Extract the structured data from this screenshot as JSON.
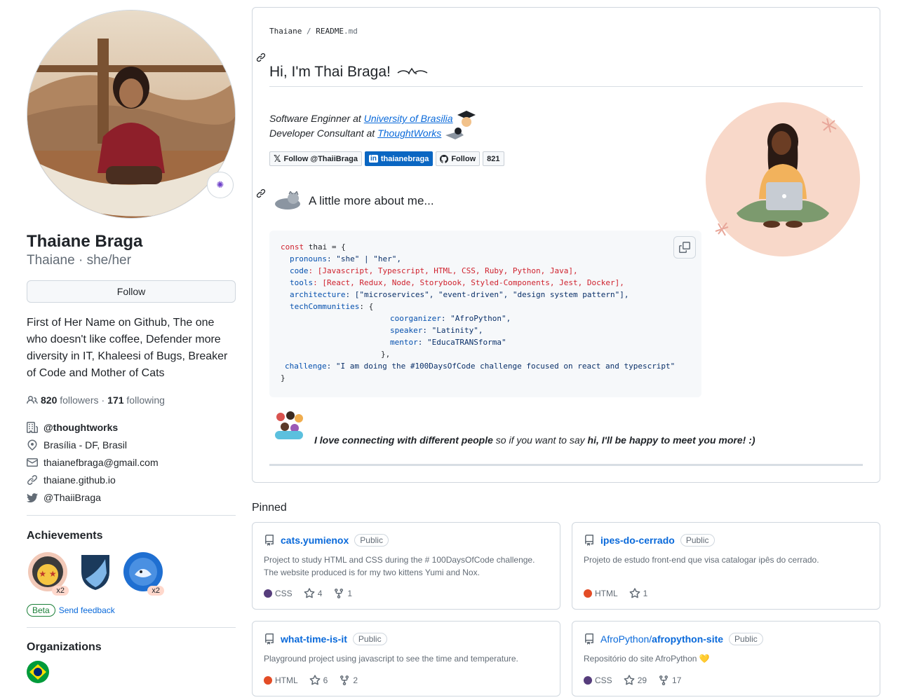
{
  "profile": {
    "name": "Thaiane Braga",
    "login": "Thaiane",
    "pronouns": "she/her",
    "follow_label": "Follow",
    "bio": "First of Her Name on Github, The one who doesn't like coffee, Defender more diversity in IT, Khaleesi of Bugs, Breaker of Code and Mother of Cats",
    "followers_count": "820",
    "followers_label": "followers",
    "following_count": "171",
    "following_label": "following",
    "company": "@thoughtworks",
    "location": "Brasília - DF, Brasil",
    "email": "thaianefbraga@gmail.com",
    "website": "thaiane.github.io",
    "twitter": "@ThaiiBraga"
  },
  "achievements": {
    "title": "Achievements",
    "items": [
      {
        "icon": "starstruck-cat-achievement-icon",
        "count": "x2"
      },
      {
        "icon": "shield-achievement-icon",
        "count": ""
      },
      {
        "icon": "shark-achievement-icon",
        "count": "x2"
      }
    ],
    "beta_label": "Beta",
    "feedback_label": "Send feedback"
  },
  "organizations": {
    "title": "Organizations"
  },
  "readme": {
    "path_user": "Thaiane",
    "path_sep": "/",
    "path_file": "README",
    "path_ext": ".md",
    "greeting": "Hi, I'm Thai Braga!",
    "job1_prefix": "Software Enginner at",
    "job1_link": "University of Brasilia",
    "job2_prefix": "Developer Consultant at",
    "job2_link": "ThoughtWorks",
    "badge_twitter": "Follow @ThaiiBraga",
    "badge_linkedin": "thaianebraga",
    "badge_github": "Follow",
    "badge_github_count": "821",
    "more_title": "A little more about me...",
    "love_lead": "I love connecting with different people",
    "love_mid": " so if you want to say ",
    "love_end": "hi, I'll be happy to meet you more! :)"
  },
  "code": {
    "l1_kw": "const",
    "l1_rest": " thai = {",
    "l2_key": "pronouns",
    "l2_val": ": \"she\" | \"her\",",
    "l3_key": "code",
    "l3_val": ": [Javascript, Typescript, HTML, CSS, Ruby, Python, Java],",
    "l4_key": "tools",
    "l4_val": ": [React, Redux, Node, Storybook, Styled-Components, Jest, Docker],",
    "l5_key": "architecture",
    "l5_val": ": [\"microservices\", \"event-driven\", \"design system pattern\"],",
    "l6_key": "techCommunities",
    "l6_val": ": {",
    "l7_key": "coorganizer",
    "l7_val": ": \"AfroPython\",",
    "l8_key": "speaker",
    "l8_val": ": \"Latinity\",",
    "l9_key": "mentor",
    "l9_val": ": \"EducaTRANSforma\"",
    "l10": "},",
    "l11_key": "challenge",
    "l11_val": ": \"I am doing the #100DaysOfCode challenge focused on react and typescript\"",
    "l12": "}"
  },
  "pinned": {
    "title": "Pinned",
    "cards": [
      {
        "owner": "",
        "name": "cats.yumienox",
        "visibility": "Public",
        "description": "Project to study HTML and CSS during the # 100DaysOfCode challenge. The website produced is for my two kittens Yumi and Nox.",
        "language": "CSS",
        "lang_color": "#563d7c",
        "stars": "4",
        "forks": "1"
      },
      {
        "owner": "",
        "name": "ipes-do-cerrado",
        "visibility": "Public",
        "description": "Projeto de estudo front-end que visa catalogar ipês do cerrado.",
        "language": "HTML",
        "lang_color": "#e34c26",
        "stars": "1",
        "forks": ""
      },
      {
        "owner": "",
        "name": "what-time-is-it",
        "visibility": "Public",
        "description": "Playground project using javascript to see the time and temperature.",
        "language": "HTML",
        "lang_color": "#e34c26",
        "stars": "6",
        "forks": "2"
      },
      {
        "owner": "AfroPython/",
        "name": "afropython-site",
        "visibility": "Public",
        "description": "Repositório do site AfroPython 💛",
        "language": "CSS",
        "lang_color": "#563d7c",
        "stars": "29",
        "forks": "17"
      }
    ]
  }
}
